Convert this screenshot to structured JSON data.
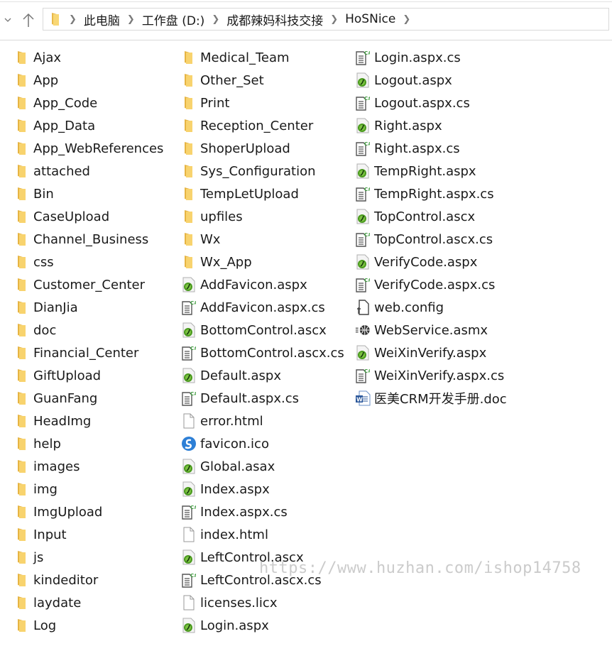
{
  "address_bar": {
    "breadcrumbs": [
      "此电脑",
      "工作盘 (D:)",
      "成都辣妈科技交接",
      "HoSNice"
    ]
  },
  "columns": [
    [
      {
        "name": "Ajax",
        "type": "folder"
      },
      {
        "name": "App",
        "type": "folder"
      },
      {
        "name": "App_Code",
        "type": "folder"
      },
      {
        "name": "App_Data",
        "type": "folder"
      },
      {
        "name": "App_WebReferences",
        "type": "folder"
      },
      {
        "name": "attached",
        "type": "folder"
      },
      {
        "name": "Bin",
        "type": "folder"
      },
      {
        "name": "CaseUpload",
        "type": "folder"
      },
      {
        "name": "Channel_Business",
        "type": "folder"
      },
      {
        "name": "css",
        "type": "folder"
      },
      {
        "name": "Customer_Center",
        "type": "folder"
      },
      {
        "name": "DianJia",
        "type": "folder"
      },
      {
        "name": "doc",
        "type": "folder"
      },
      {
        "name": "Financial_Center",
        "type": "folder"
      },
      {
        "name": "GiftUpload",
        "type": "folder"
      },
      {
        "name": "GuanFang",
        "type": "folder"
      },
      {
        "name": "HeadImg",
        "type": "folder"
      },
      {
        "name": "help",
        "type": "folder"
      },
      {
        "name": "images",
        "type": "folder"
      },
      {
        "name": "img",
        "type": "folder"
      },
      {
        "name": "ImgUpload",
        "type": "folder"
      },
      {
        "name": "Input",
        "type": "folder"
      },
      {
        "name": "js",
        "type": "folder"
      },
      {
        "name": "kindeditor",
        "type": "folder"
      },
      {
        "name": "laydate",
        "type": "folder"
      },
      {
        "name": "Log",
        "type": "folder"
      }
    ],
    [
      {
        "name": "Medical_Team",
        "type": "folder"
      },
      {
        "name": "Other_Set",
        "type": "folder"
      },
      {
        "name": "Print",
        "type": "folder"
      },
      {
        "name": "Reception_Center",
        "type": "folder"
      },
      {
        "name": "ShoperUpload",
        "type": "folder"
      },
      {
        "name": "Sys_Configuration",
        "type": "folder"
      },
      {
        "name": "TempLetUpload",
        "type": "folder"
      },
      {
        "name": "upfiles",
        "type": "folder"
      },
      {
        "name": "Wx",
        "type": "folder"
      },
      {
        "name": "Wx_App",
        "type": "folder"
      },
      {
        "name": "AddFavicon.aspx",
        "type": "aspx"
      },
      {
        "name": "AddFavicon.aspx.cs",
        "type": "cs"
      },
      {
        "name": "BottomControl.ascx",
        "type": "aspx"
      },
      {
        "name": "BottomControl.ascx.cs",
        "type": "cs"
      },
      {
        "name": "Default.aspx",
        "type": "aspx"
      },
      {
        "name": "Default.aspx.cs",
        "type": "cs"
      },
      {
        "name": "error.html",
        "type": "blank"
      },
      {
        "name": "favicon.ico",
        "type": "ico"
      },
      {
        "name": "Global.asax",
        "type": "aspx"
      },
      {
        "name": "Index.aspx",
        "type": "aspx"
      },
      {
        "name": "Index.aspx.cs",
        "type": "cs"
      },
      {
        "name": "index.html",
        "type": "blank"
      },
      {
        "name": "LeftControl.ascx",
        "type": "aspx"
      },
      {
        "name": "LeftControl.ascx.cs",
        "type": "cs"
      },
      {
        "name": "licenses.licx",
        "type": "blank"
      },
      {
        "name": "Login.aspx",
        "type": "aspx"
      }
    ],
    [
      {
        "name": "Login.aspx.cs",
        "type": "cs"
      },
      {
        "name": "Logout.aspx",
        "type": "aspx"
      },
      {
        "name": "Logout.aspx.cs",
        "type": "cs"
      },
      {
        "name": "Right.aspx",
        "type": "aspx"
      },
      {
        "name": "Right.aspx.cs",
        "type": "cs"
      },
      {
        "name": "TempRight.aspx",
        "type": "aspx"
      },
      {
        "name": "TempRight.aspx.cs",
        "type": "cs"
      },
      {
        "name": "TopControl.ascx",
        "type": "aspx"
      },
      {
        "name": "TopControl.ascx.cs",
        "type": "cs"
      },
      {
        "name": "VerifyCode.aspx",
        "type": "aspx"
      },
      {
        "name": "VerifyCode.aspx.cs",
        "type": "cs"
      },
      {
        "name": "web.config",
        "type": "config"
      },
      {
        "name": "WebService.asmx",
        "type": "asmx"
      },
      {
        "name": "WeiXinVerify.aspx",
        "type": "aspx"
      },
      {
        "name": "WeiXinVerify.aspx.cs",
        "type": "cs"
      },
      {
        "name": "医美CRM开发手册.doc",
        "type": "doc"
      }
    ]
  ],
  "watermark": "https://www.huzhan.com/ishop14758",
  "colors": {
    "folder": "#f5d06b",
    "aspx_green": "#4a9a1e",
    "cs_green": "#3c9a3c",
    "word_blue": "#2b579a"
  }
}
